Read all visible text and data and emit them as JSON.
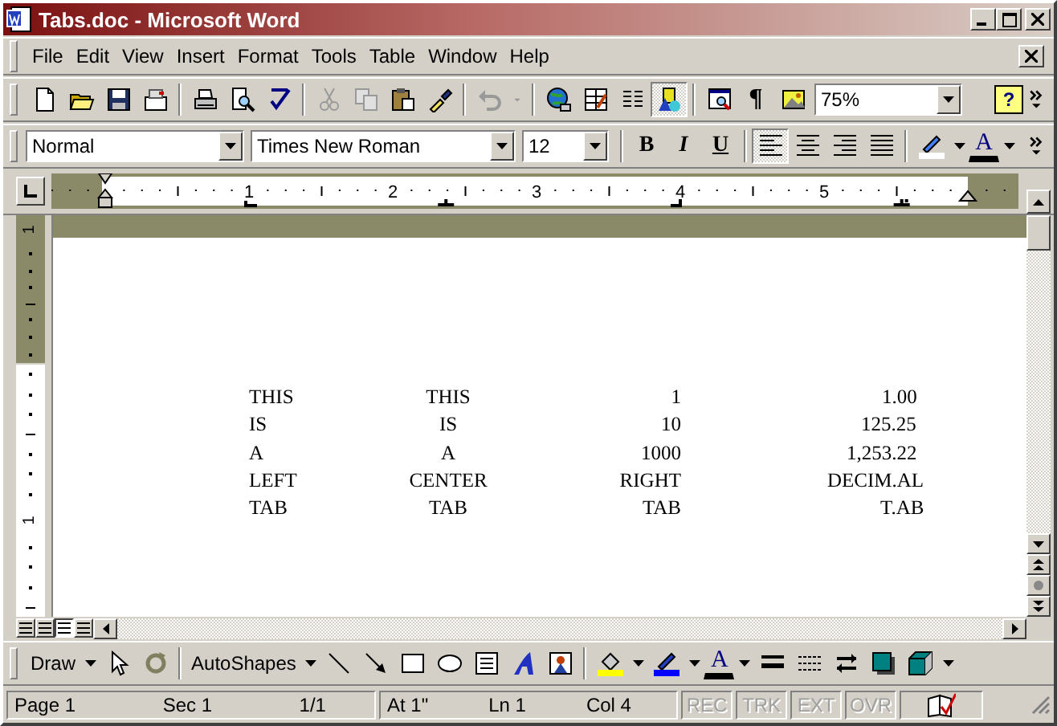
{
  "window": {
    "title": "Tabs.doc - Microsoft Word"
  },
  "menu": [
    "File",
    "Edit",
    "View",
    "Insert",
    "Format",
    "Tools",
    "Table",
    "Window",
    "Help"
  ],
  "standard_toolbar": {
    "drawing_button_on": true,
    "show_hide": "¶",
    "zoom": "75%",
    "help": "?"
  },
  "formatting_toolbar": {
    "style": "Normal",
    "font": "Times New Roman",
    "size": "12",
    "font_styles": [
      {
        "kind": "bold",
        "label": "B",
        "on": false
      },
      {
        "kind": "italic",
        "label": "I",
        "on": false
      },
      {
        "kind": "underline",
        "label": "U",
        "on": false
      }
    ],
    "alignment": [
      {
        "kind": "left",
        "selected": true
      },
      {
        "kind": "center",
        "selected": false
      },
      {
        "kind": "right",
        "selected": false
      },
      {
        "kind": "justify",
        "selected": false
      }
    ],
    "font_color": "A"
  },
  "ruler": {
    "numbers": [
      "1",
      "2",
      "3",
      "4",
      "5"
    ],
    "tab_stops": [
      {
        "kind": "left"
      },
      {
        "kind": "center"
      },
      {
        "kind": "right"
      },
      {
        "kind": "decimal"
      }
    ]
  },
  "vertical_ruler": {
    "numbers": [
      "1",
      "1"
    ]
  },
  "document": {
    "lines": [
      [
        "THIS",
        "THIS",
        "1",
        "1.00"
      ],
      [
        "IS",
        "IS",
        "10",
        "125.25"
      ],
      [
        "A",
        "A",
        "1000",
        "1,253.22"
      ],
      [
        "LEFT",
        "CENTER",
        "RIGHT",
        "DECIM.AL"
      ],
      [
        "TAB",
        "TAB",
        "TAB",
        "T.AB"
      ]
    ]
  },
  "drawing_toolbar": {
    "draw": "Draw",
    "autoshapes": "AutoShapes",
    "font_color": "A"
  },
  "status_bar": {
    "page": "Page 1",
    "section": "Sec 1",
    "pages": "1/1",
    "at": "At 1\"",
    "line": "Ln 1",
    "column": "Col 4",
    "modes": [
      {
        "label": "REC",
        "disabled": true
      },
      {
        "label": "TRK",
        "disabled": true
      },
      {
        "label": "EXT",
        "disabled": true
      },
      {
        "label": "OVR",
        "disabled": true
      }
    ]
  }
}
